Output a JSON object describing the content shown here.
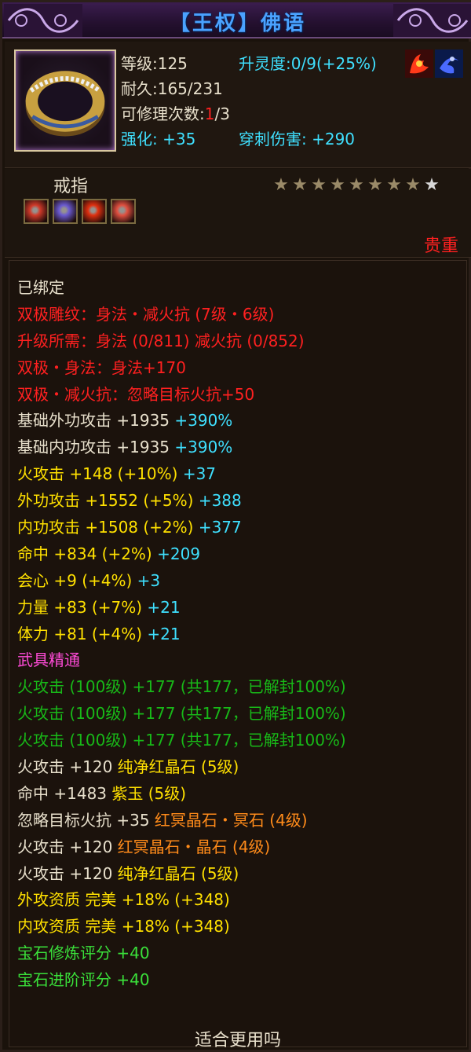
{
  "window": {
    "title": "【王权】佛语",
    "title_color": "#4aa2ff"
  },
  "header": {
    "level_label": "等级:125",
    "spirit_label": "升灵度:0/9",
    "spirit_bonus": "(+25%)",
    "durability_label": "耐久:165/231",
    "repair_label": "可修理次数:",
    "repair_current": "1",
    "repair_total": "/3",
    "enhance_label": "强化: +35",
    "pierce_label": "穿刺伤害: +290",
    "icons": [
      "fire-dragon-icon",
      "blue-swirl-icon"
    ]
  },
  "item": {
    "type": "戒指",
    "stars_total": 9,
    "stars_lit": 8,
    "star_glyph": "★",
    "gems": [
      {
        "name": "gem-slot-red-icon",
        "color": "#d03a2a"
      },
      {
        "name": "gem-slot-purple-icon",
        "color": "#6a5ad0"
      },
      {
        "name": "gem-slot-fire-icon",
        "color": "#e03010"
      },
      {
        "name": "gem-slot-red-gold-icon",
        "color": "#e05040"
      }
    ],
    "rarity": "贵重"
  },
  "attributes": [
    [
      {
        "t": "已绑定",
        "c": "c-white"
      }
    ],
    [
      {
        "t": "双极雕纹：身法・减火抗 (7级・6级)",
        "c": "c-red"
      }
    ],
    [
      {
        "t": "升级所需：身法 (0/811)  减火抗 (0/852)",
        "c": "c-red"
      }
    ],
    [
      {
        "t": "双极・身法：身法+170",
        "c": "c-red"
      }
    ],
    [
      {
        "t": "双极・减火抗：忽略目标火抗+50",
        "c": "c-red"
      }
    ],
    [
      {
        "t": "基础外功攻击 +1935 ",
        "c": "c-white"
      },
      {
        "t": "+390%",
        "c": "c-cyan"
      }
    ],
    [
      {
        "t": "基础内功攻击 +1935 ",
        "c": "c-white"
      },
      {
        "t": "+390%",
        "c": "c-cyan"
      }
    ],
    [
      {
        "t": "火攻击 +148 (+10%) ",
        "c": "c-yellow"
      },
      {
        "t": "+37",
        "c": "c-cyan"
      }
    ],
    [
      {
        "t": "外功攻击 +1552 (+5%) ",
        "c": "c-yellow"
      },
      {
        "t": "+388",
        "c": "c-cyan"
      }
    ],
    [
      {
        "t": "内功攻击 +1508 (+2%) ",
        "c": "c-yellow"
      },
      {
        "t": "+377",
        "c": "c-cyan"
      }
    ],
    [
      {
        "t": "命中 +834 (+2%) ",
        "c": "c-yellow"
      },
      {
        "t": "+209",
        "c": "c-cyan"
      }
    ],
    [
      {
        "t": "会心 +9 (+4%) ",
        "c": "c-yellow"
      },
      {
        "t": "+3",
        "c": "c-cyan"
      }
    ],
    [
      {
        "t": "力量 +83 (+7%) ",
        "c": "c-yellow"
      },
      {
        "t": "+21",
        "c": "c-cyan"
      }
    ],
    [
      {
        "t": "体力 +81 (+4%) ",
        "c": "c-yellow"
      },
      {
        "t": "+21",
        "c": "c-cyan"
      }
    ],
    [
      {
        "t": "武具精通",
        "c": "c-pink"
      }
    ],
    [
      {
        "t": "火攻击 (100级) +177 (共177，已解封100%)",
        "c": "c-green"
      }
    ],
    [
      {
        "t": "火攻击 (100级) +177 (共177，已解封100%)",
        "c": "c-green"
      }
    ],
    [
      {
        "t": "火攻击 (100级) +177 (共177，已解封100%)",
        "c": "c-green"
      }
    ],
    [
      {
        "t": "火攻击 +120 ",
        "c": "c-white"
      },
      {
        "t": "纯净红晶石 (5级)",
        "c": "c-yellow"
      }
    ],
    [
      {
        "t": "命中 +1483 ",
        "c": "c-white"
      },
      {
        "t": "紫玉 (5级)",
        "c": "c-yellow"
      }
    ],
    [
      {
        "t": "忽略目标火抗 +35 ",
        "c": "c-white"
      },
      {
        "t": "红冥晶石・冥石 (4级)",
        "c": "c-orange"
      }
    ],
    [
      {
        "t": "火攻击 +120 ",
        "c": "c-white"
      },
      {
        "t": "红冥晶石・晶石 (4级)",
        "c": "c-orange"
      }
    ],
    [
      {
        "t": "火攻击 +120 ",
        "c": "c-white"
      },
      {
        "t": "纯净红晶石 (5级)",
        "c": "c-yellow"
      }
    ],
    [
      {
        "t": "外攻资质   完美 +18% (+348)",
        "c": "c-yellow"
      }
    ],
    [
      {
        "t": "内攻资质   完美 +18% (+348)",
        "c": "c-yellow"
      }
    ],
    [
      {
        "t": "宝石修炼评分 +40",
        "c": "c-lime"
      }
    ],
    [
      {
        "t": "宝石进阶评分 +40",
        "c": "c-lime"
      }
    ]
  ],
  "footer": {
    "text": "适合更用吗"
  }
}
